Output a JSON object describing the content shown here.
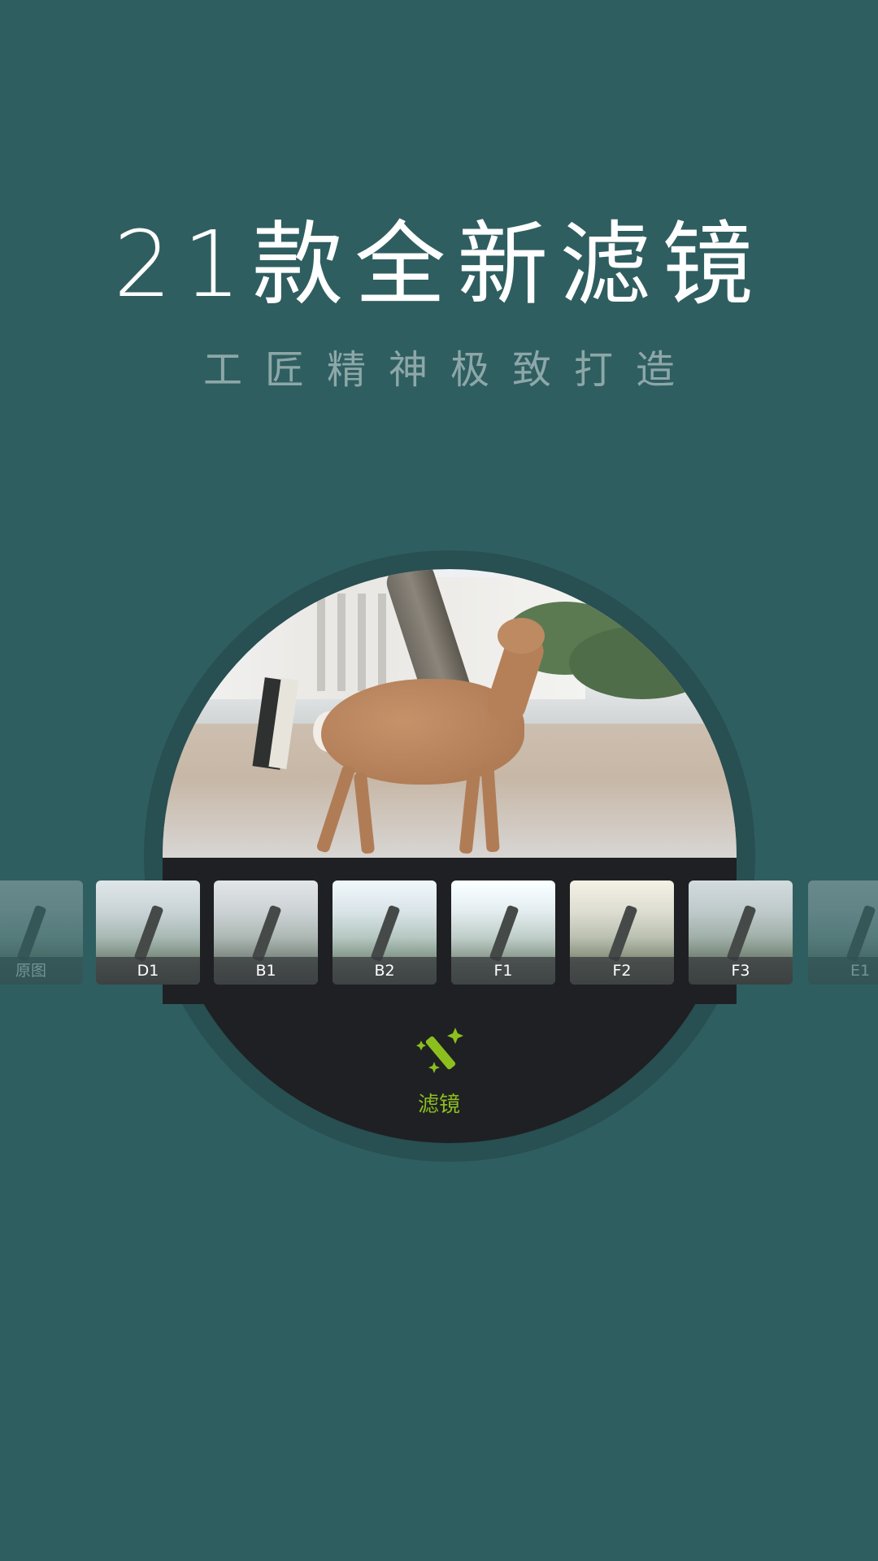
{
  "headline": "21款全新滤镜",
  "subheadline": "工匠精神极致打造",
  "filters": [
    {
      "label": "原图",
      "state": "faded"
    },
    {
      "label": "D1",
      "state": "normal"
    },
    {
      "label": "B1",
      "state": "normal"
    },
    {
      "label": "B2",
      "state": "normal"
    },
    {
      "label": "F1",
      "state": "normal"
    },
    {
      "label": "F2",
      "state": "normal"
    },
    {
      "label": "F3",
      "state": "normal"
    },
    {
      "label": "E1",
      "state": "faded"
    }
  ],
  "toolbar": {
    "filter_label": "滤镜",
    "filter_icon": "magic-wand-icon"
  },
  "colors": {
    "background": "#2f5e60",
    "panel": "#1f2023",
    "accent": "#8cbf1e"
  }
}
